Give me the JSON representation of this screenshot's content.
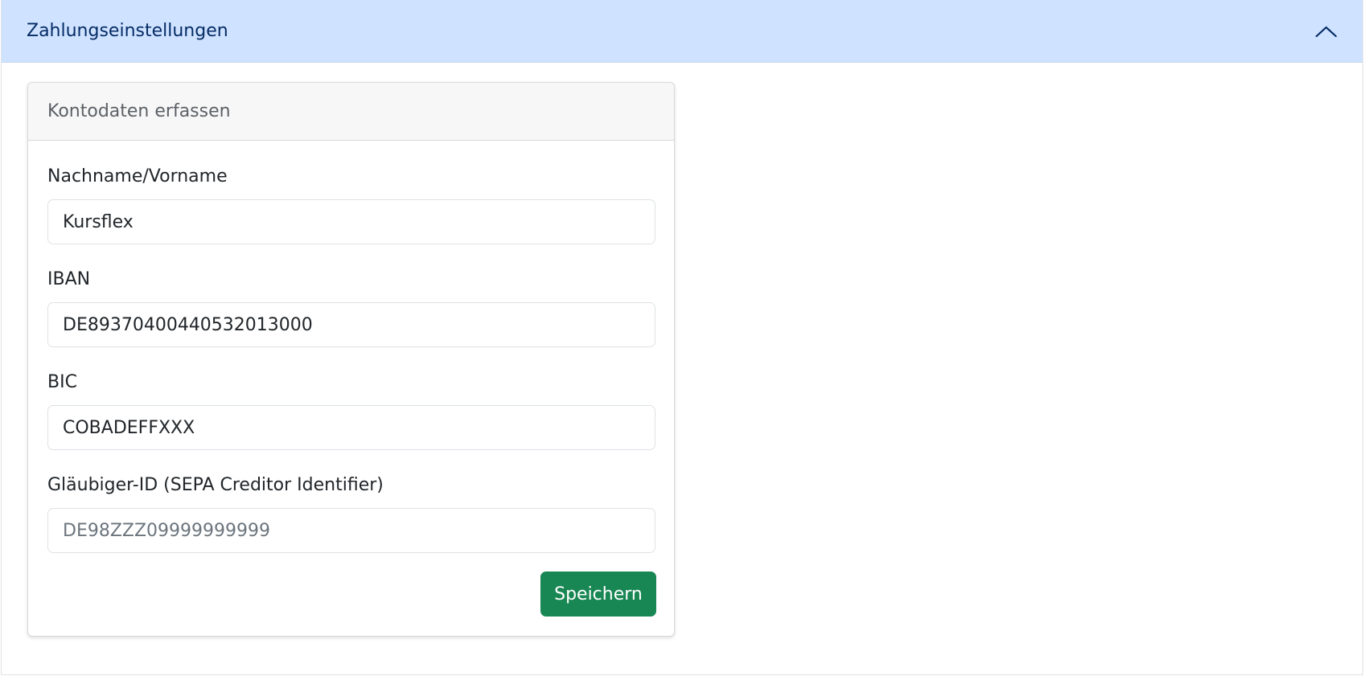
{
  "accordion": {
    "title": "Zahlungseinstellungen",
    "expanded": true,
    "toggle_icon": "chevron-up-icon",
    "header_color": "#cfe2ff"
  },
  "card": {
    "title": "Kontodaten erfassen"
  },
  "form": {
    "name": {
      "label": "Nachname/Vorname",
      "value": "Kursflex",
      "placeholder": ""
    },
    "iban": {
      "label": "IBAN",
      "value": "DE89370400440532013000",
      "placeholder": ""
    },
    "bic": {
      "label": "BIC",
      "value": "COBADEFFXXX",
      "placeholder": ""
    },
    "creditor_id": {
      "label": "Gläubiger-ID (SEPA Creditor Identifier)",
      "value": "",
      "placeholder": "DE98ZZZ09999999999"
    },
    "save_label": "Speichern",
    "save_color": "#198754"
  }
}
